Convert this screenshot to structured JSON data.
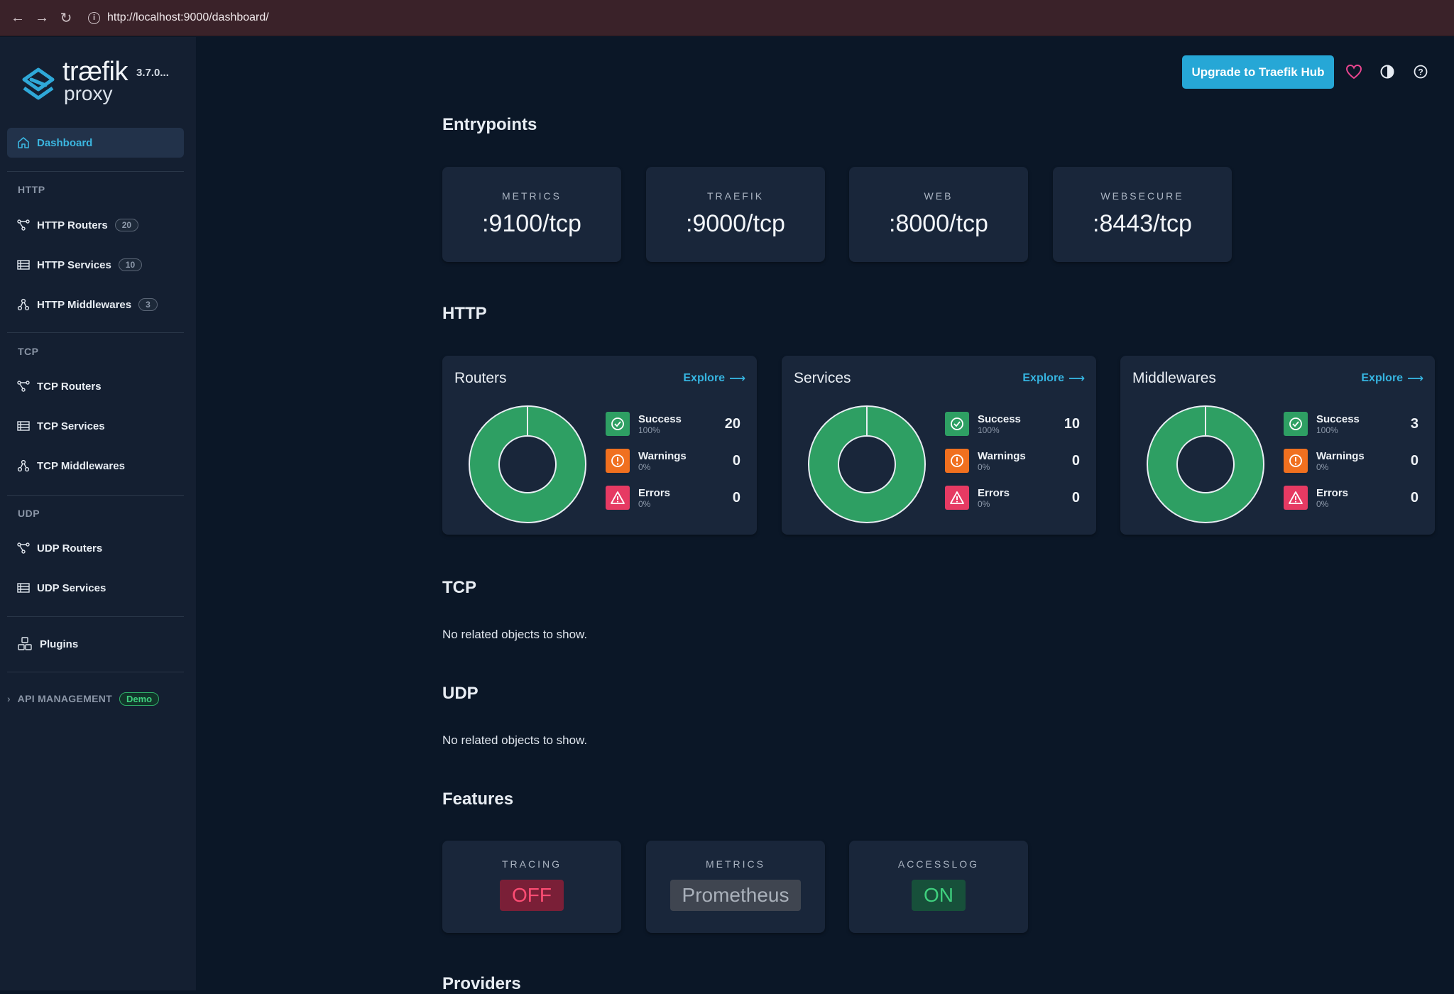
{
  "browser": {
    "url": "http://localhost:9000/dashboard/"
  },
  "brand": {
    "name": "træfik",
    "sub": "proxy",
    "version": "3.7.0..."
  },
  "sidebar": {
    "dashboard": "Dashboard",
    "http_label": "HTTP",
    "http_routers": "HTTP Routers",
    "http_routers_count": "20",
    "http_services": "HTTP Services",
    "http_services_count": "10",
    "http_middlewares": "HTTP Middlewares",
    "http_middlewares_count": "3",
    "tcp_label": "TCP",
    "tcp_routers": "TCP Routers",
    "tcp_services": "TCP Services",
    "tcp_middlewares": "TCP Middlewares",
    "udp_label": "UDP",
    "udp_routers": "UDP Routers",
    "udp_services": "UDP Services",
    "plugins": "Plugins",
    "api_management": "API MANAGEMENT",
    "demo": "Demo"
  },
  "header": {
    "upgrade": "Upgrade to Traefik Hub"
  },
  "entrypoints": {
    "title": "Entrypoints",
    "items": [
      {
        "name": "METRICS",
        "addr": ":9100/tcp"
      },
      {
        "name": "TRAEFIK",
        "addr": ":9000/tcp"
      },
      {
        "name": "WEB",
        "addr": ":8000/tcp"
      },
      {
        "name": "WEBSECURE",
        "addr": ":8443/tcp"
      }
    ]
  },
  "http": {
    "title": "HTTP",
    "explore": "Explore",
    "cards": [
      {
        "title": "Routers",
        "success": "20",
        "warnings": "0",
        "errors": "0"
      },
      {
        "title": "Services",
        "success": "10",
        "warnings": "0",
        "errors": "0"
      },
      {
        "title": "Middlewares",
        "success": "3",
        "warnings": "0",
        "errors": "0"
      }
    ],
    "labels": {
      "success": "Success",
      "warnings": "Warnings",
      "errors": "Errors",
      "success_pct": "100%",
      "warnings_pct": "0%",
      "errors_pct": "0%"
    }
  },
  "tcp": {
    "title": "TCP",
    "empty": "No related objects to show."
  },
  "udp": {
    "title": "UDP",
    "empty": "No related objects to show."
  },
  "features": {
    "title": "Features",
    "items": [
      {
        "name": "TRACING",
        "value": "OFF"
      },
      {
        "name": "METRICS",
        "value": "Prometheus"
      },
      {
        "name": "ACCESSLOG",
        "value": "ON"
      }
    ]
  },
  "providers": {
    "title": "Providers"
  },
  "colors": {
    "success": "#2e9f63",
    "warning": "#f0701f",
    "error": "#e63a63",
    "accent": "#26a7d6"
  }
}
